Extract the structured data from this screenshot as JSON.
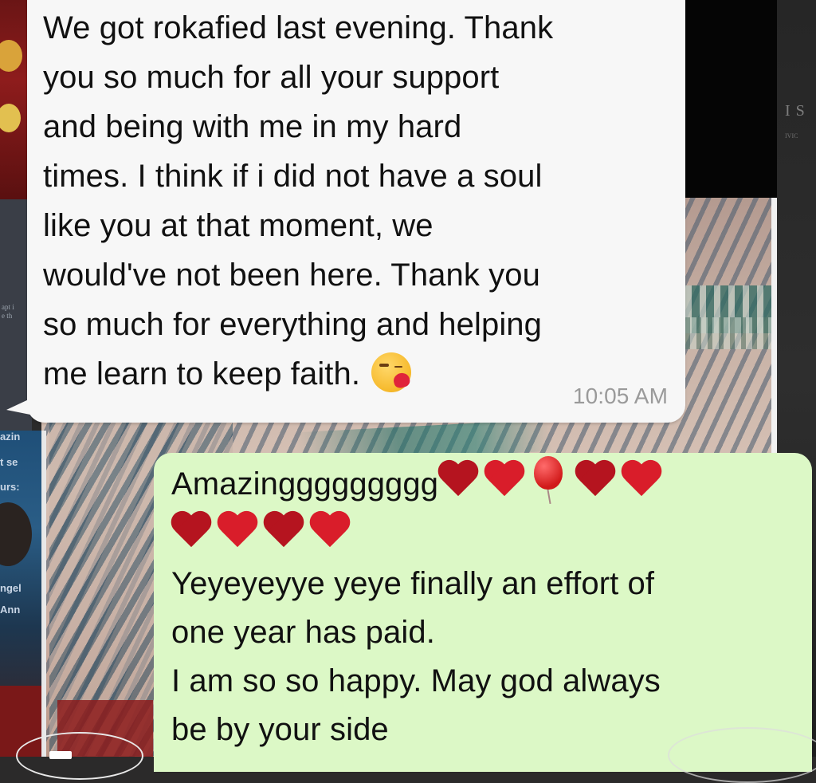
{
  "background": {
    "left_small_text": [
      "apt i",
      "e th"
    ],
    "left_strip_labels": [
      "azin",
      "t se",
      "urs:",
      "ngel",
      "Ann"
    ],
    "right_text": "I S",
    "right_small_text": "IVIC"
  },
  "incoming_message": {
    "lines": [
      "We got rokafied last evening. Thank",
      "you so much for all your support",
      "and being with me in my hard",
      "times. I think if i did not have a soul",
      "like you at that moment, we",
      "would've not been here. Thank you",
      "so much for everything and helping",
      "me learn to keep faith."
    ],
    "emoji": "kissing-face-with-heart",
    "time": "10:05 AM"
  },
  "outgoing_message": {
    "first_word": "Amazinggggggggg",
    "emojis_line1": [
      "red-heart",
      "red-heart",
      "red-balloon",
      "red-heart",
      "red-heart"
    ],
    "emojis_line2": [
      "red-heart",
      "red-heart",
      "red-heart",
      "red-heart"
    ],
    "lines": [
      "Yeyeyeyye yeye finally an effort of",
      "one year has paid.",
      "I am so so happy. May god always",
      "be by your side"
    ]
  },
  "colors": {
    "incoming_bubble": "#f7f7f7",
    "outgoing_bubble": "#dcf8c6",
    "time_text": "#9a9a9a",
    "heart": "#d91d2a"
  }
}
